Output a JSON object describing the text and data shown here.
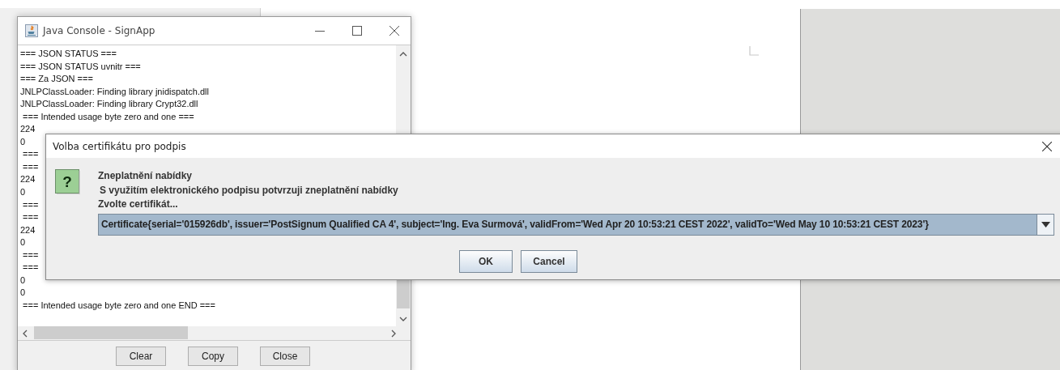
{
  "console": {
    "title": "Java Console - SignApp",
    "lines": [
      "=== JSON STATUS ===",
      "=== JSON STATUS uvnitr ===",
      "=== Za JSON ===",
      "JNLPClassLoader: Finding library jnidispatch.dll",
      "JNLPClassLoader: Finding library Crypt32.dll",
      " === Intended usage byte zero and one ===",
      "224",
      "0",
      " ===",
      " ===",
      "224",
      "0",
      " ===",
      " ===",
      "224",
      "0",
      " ===",
      " ===",
      "0",
      "0",
      " === Intended usage byte zero and one END ==="
    ],
    "buttons": [
      "Clear",
      "Copy",
      "Close"
    ]
  },
  "dialog": {
    "title": "Volba certifikátu pro podpis",
    "icon_glyph": "?",
    "heading": "Zneplatnění nabídky",
    "message": "S využitím elektronického podpisu potvrzuji zneplatnění nabídky",
    "prompt": "Zvolte certifikát...",
    "combo": {
      "value": "Certificate{serial='015926db', issuer='PostSignum Qualified CA 4', subject='Ing. Eva Surmová', validFrom='Wed Apr 20 10:53:21 CEST 2022', validTo='Wed May 10 10:53:21 CEST 2023'}"
    },
    "buttons": [
      "OK",
      "Cancel"
    ]
  }
}
